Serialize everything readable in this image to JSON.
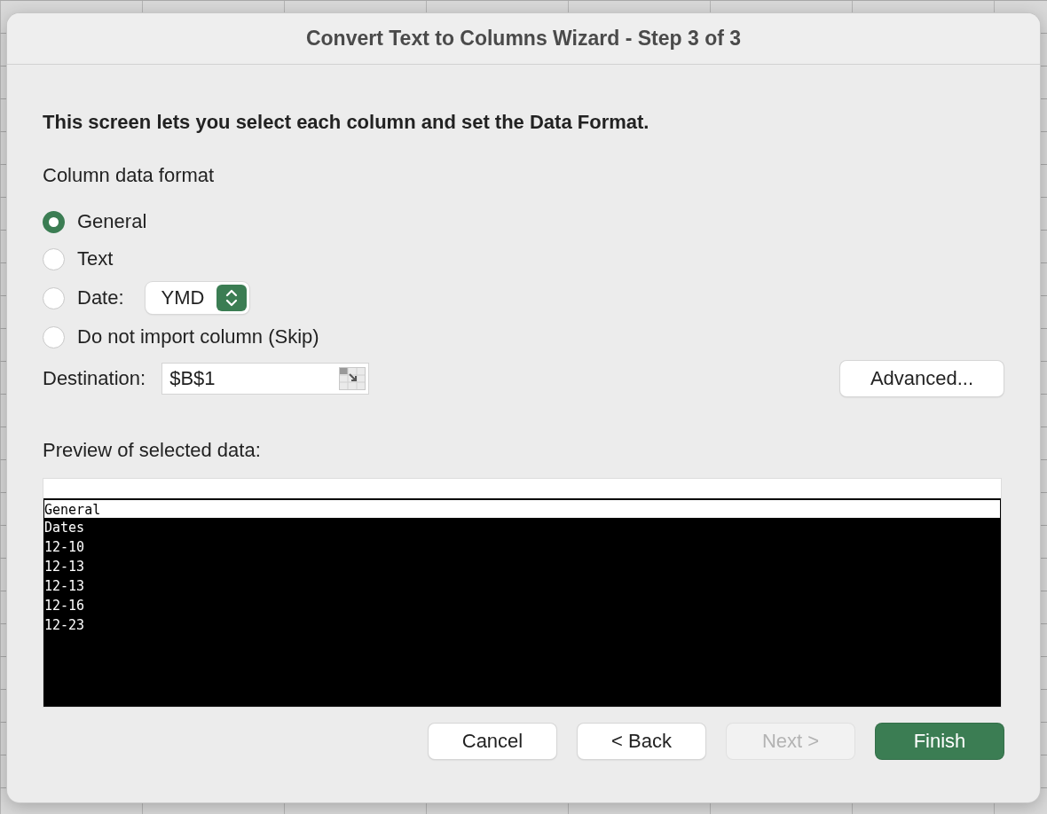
{
  "window": {
    "title": "Convert Text to Columns Wizard - Step 3 of 3"
  },
  "instruction": "This screen lets you select each column and set the Data Format.",
  "format_group": {
    "label": "Column data format",
    "options": [
      {
        "label": "General",
        "selected": true,
        "kind": "plain"
      },
      {
        "label": "Text",
        "selected": false,
        "kind": "plain"
      },
      {
        "label": "Date:",
        "selected": false,
        "kind": "date",
        "popup": "YMD"
      },
      {
        "label": "Do not import column (Skip)",
        "selected": false,
        "kind": "plain"
      }
    ]
  },
  "destination": {
    "label": "Destination:",
    "value": "$B$1"
  },
  "advanced_button": "Advanced...",
  "preview": {
    "label": "Preview of selected data:",
    "column_format": "General",
    "rows": [
      "Dates",
      "12-10",
      "12-13",
      "12-13",
      "12-16",
      "12-23"
    ]
  },
  "buttons": [
    {
      "label": "Cancel",
      "disabled": false,
      "default": false
    },
    {
      "label": "< Back",
      "disabled": false,
      "default": false
    },
    {
      "label": "Next >",
      "disabled": true,
      "default": false
    },
    {
      "label": "Finish",
      "disabled": false,
      "default": true
    }
  ]
}
